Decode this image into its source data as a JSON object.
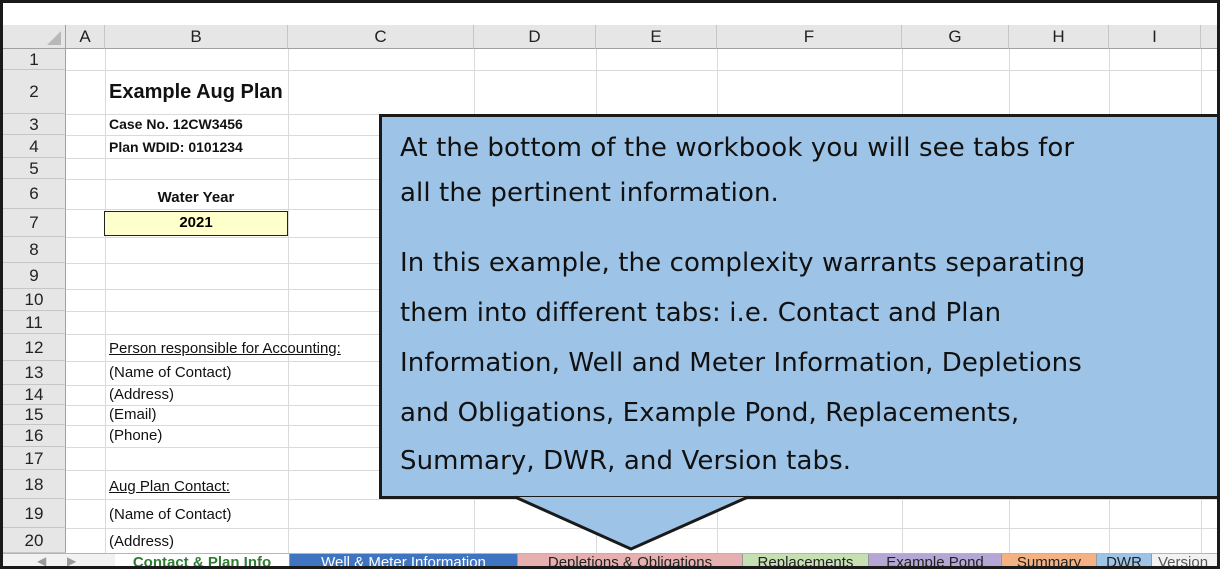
{
  "columns": [
    "A",
    "B",
    "C",
    "D",
    "E",
    "F",
    "G",
    "H",
    "I"
  ],
  "rows": [
    "1",
    "2",
    "3",
    "4",
    "5",
    "6",
    "7",
    "8",
    "9",
    "10",
    "11",
    "12",
    "13",
    "14",
    "15",
    "16",
    "17",
    "18",
    "19",
    "20"
  ],
  "cells": {
    "title": "Example Aug Plan",
    "case_no": "Case No. 12CW3456",
    "plan_wdid": "Plan WDID: 0101234",
    "water_year_label": "Water Year",
    "water_year_value": "2021",
    "person_responsible": "Person responsible for Accounting:",
    "name_of_contact_1": "(Name of Contact)",
    "address_1": "(Address)",
    "email_1": "(Email)",
    "phone_1": "(Phone)",
    "aug_plan_contact": "Aug Plan Contact:",
    "name_of_contact_2": "(Name of Contact)",
    "address_2": "(Address)"
  },
  "callout": {
    "lines": [
      "At the bottom of the workbook you will see tabs for",
      "all the pertinent information.",
      "In this example, the complexity warrants separating",
      "them into different tabs: i.e. Contact and Plan",
      "Information, Well and Meter Information, Depletions",
      "and Obligations, Example Pond, Replacements,",
      "Summary, DWR, and Version tabs."
    ],
    "color": "#9dc3e6"
  },
  "tabs": [
    {
      "label": "Contact & Plan Info",
      "color": "#ffffff",
      "text": "#2e7d32",
      "active": true
    },
    {
      "label": "Well & Meter Information",
      "color": "#3f74c0",
      "text": "#ffffff"
    },
    {
      "label": "Depletions & Obligations",
      "color": "#e6b0b0",
      "text": "#222222"
    },
    {
      "label": "Replacements",
      "color": "#c6e0b4",
      "text": "#222222"
    },
    {
      "label": "Example Pond",
      "color": "#b4a7d6",
      "text": "#222222"
    },
    {
      "label": "Summary",
      "color": "#f4b183",
      "text": "#222222"
    },
    {
      "label": "DWR",
      "color": "#9dc3e6",
      "text": "#222222"
    },
    {
      "label": "Version",
      "color": "#f2f2f2",
      "text": "#555555"
    }
  ],
  "nav_icons": [
    "scroll-left-icon",
    "scroll-right-icon"
  ]
}
